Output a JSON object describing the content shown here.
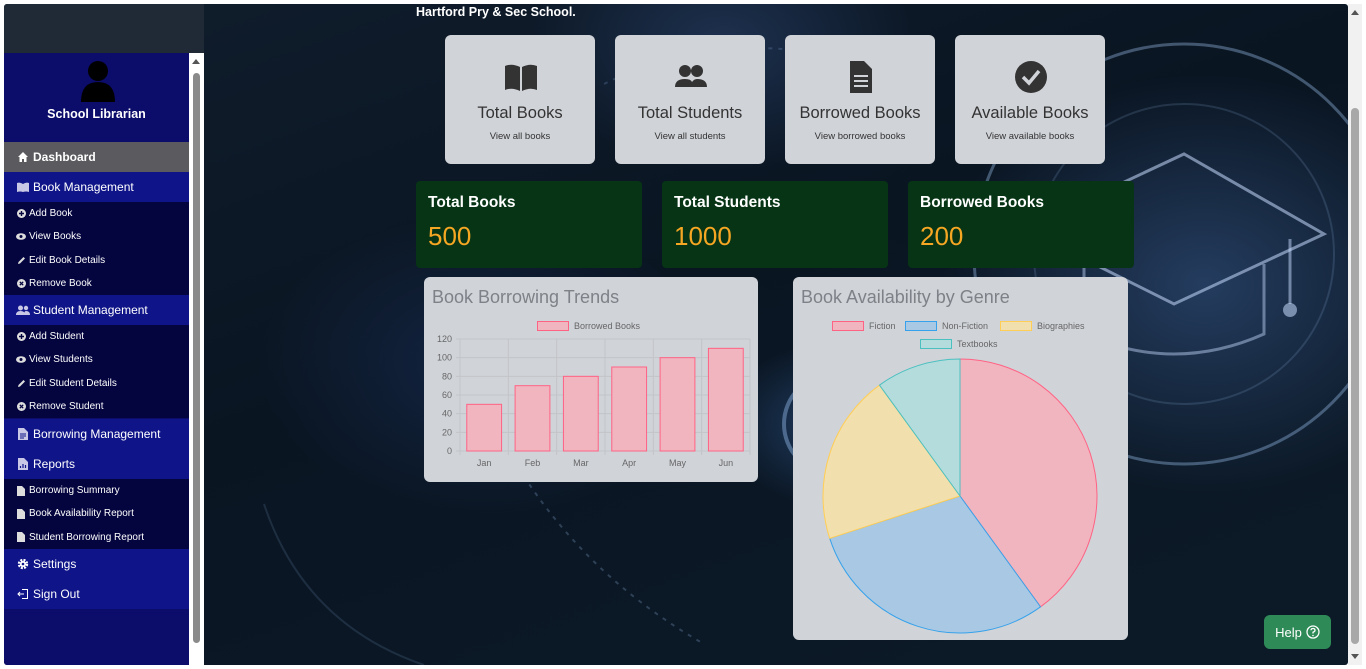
{
  "header": {
    "school_name": "Hartford Pry & Sec School."
  },
  "sidebar": {
    "role": "School Librarian",
    "items": [
      {
        "label": "Dashboard",
        "icon": "home-icon"
      },
      {
        "label": "Book Management",
        "icon": "book-icon"
      },
      {
        "label": "Add Book",
        "icon": "plus-circle-icon"
      },
      {
        "label": "View Books",
        "icon": "eye-icon"
      },
      {
        "label": "Edit Book Details",
        "icon": "pencil-icon"
      },
      {
        "label": "Remove Book",
        "icon": "x-circle-icon"
      },
      {
        "label": "Student Management",
        "icon": "users-icon"
      },
      {
        "label": "Add Student",
        "icon": "plus-circle-icon"
      },
      {
        "label": "View Students",
        "icon": "eye-icon"
      },
      {
        "label": "Edit Student Details",
        "icon": "pencil-icon"
      },
      {
        "label": "Remove Student",
        "icon": "x-circle-icon"
      },
      {
        "label": "Borrowing Management",
        "icon": "document-icon"
      },
      {
        "label": "Reports",
        "icon": "report-icon"
      },
      {
        "label": "Borrowing Summary",
        "icon": "document-icon"
      },
      {
        "label": "Book Availability Report",
        "icon": "document-icon"
      },
      {
        "label": "Student Borrowing Report",
        "icon": "document-icon"
      },
      {
        "label": "Settings",
        "icon": "gear-icon"
      },
      {
        "label": "Sign Out",
        "icon": "sign-out-icon"
      }
    ]
  },
  "cards": [
    {
      "title": "Total Books",
      "subtitle": "View all books",
      "icon": "book-icon"
    },
    {
      "title": "Total Students",
      "subtitle": "View all students",
      "icon": "users-icon"
    },
    {
      "title": "Borrowed Books",
      "subtitle": "View borrowed books",
      "icon": "document-icon"
    },
    {
      "title": "Available Books",
      "subtitle": "View available books",
      "icon": "check-circle-icon"
    }
  ],
  "stats": [
    {
      "title": "Total Books",
      "value": "500"
    },
    {
      "title": "Total Students",
      "value": "1000"
    },
    {
      "title": "Borrowed Books",
      "value": "200"
    }
  ],
  "colors": {
    "sidebar": "#0c0c6b",
    "stat_bg": "#063415",
    "stat_value": "#f5a623",
    "help": "#2e8b57"
  },
  "chart_data": [
    {
      "type": "bar",
      "title": "Book Borrowing Trends",
      "categories": [
        "Jan",
        "Feb",
        "Mar",
        "Apr",
        "May",
        "Jun"
      ],
      "series": [
        {
          "name": "Borrowed Books",
          "values": [
            50,
            70,
            80,
            90,
            100,
            110
          ]
        }
      ],
      "ylim": [
        0,
        120
      ],
      "yticks": [
        0,
        20,
        40,
        60,
        80,
        100,
        120
      ],
      "grid": true,
      "legend": "top"
    },
    {
      "type": "pie",
      "title": "Book Availability by Genre",
      "labels": [
        "Fiction",
        "Non-Fiction",
        "Biographies",
        "Textbooks"
      ],
      "values": [
        40,
        30,
        20,
        10
      ],
      "colors": [
        "#f1b5c0",
        "#a9c8e4",
        "#f2dfae",
        "#b4dcdc"
      ],
      "borders": [
        "#ff6384",
        "#36a2eb",
        "#ffce56",
        "#4bc0c0"
      ],
      "legend": "top"
    }
  ],
  "help": {
    "label": "Help"
  }
}
